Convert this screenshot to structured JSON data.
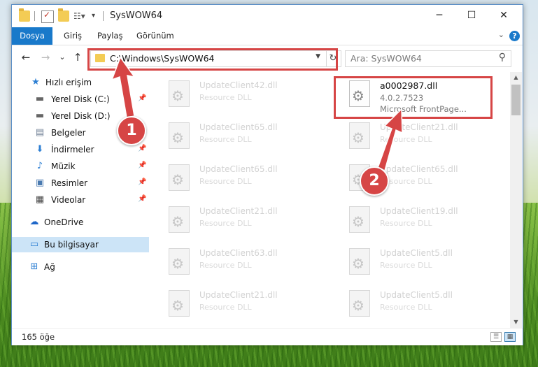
{
  "window": {
    "title": "SysWOW64",
    "minimize": "─",
    "maximize": "☐",
    "close": "✕"
  },
  "ribbon": {
    "tabs": [
      "Dosya",
      "Giriş",
      "Paylaş",
      "Görünüm"
    ],
    "help": "?"
  },
  "nav": {
    "back": "←",
    "forward": "→",
    "recent": "⌄",
    "up": "↑",
    "address": "C:\\Windows\\SysWOW64",
    "refresh": "↻",
    "search_placeholder": "Ara: SysWOW64"
  },
  "sidebar": {
    "items": [
      {
        "label": "Hızlı erişim",
        "icon": "star-icon",
        "color": "#2d7fd3"
      },
      {
        "label": "Yerel Disk (C:)",
        "icon": "drive-icon"
      },
      {
        "label": "Yerel Disk (D:)",
        "icon": "drive-icon"
      },
      {
        "label": "Belgeler",
        "icon": "documents-icon"
      },
      {
        "label": "İndirmeler",
        "icon": "download-icon"
      },
      {
        "label": "Müzik",
        "icon": "music-icon"
      },
      {
        "label": "Resimler",
        "icon": "pictures-icon"
      },
      {
        "label": "Videolar",
        "icon": "videos-icon"
      },
      {
        "label": "OneDrive",
        "icon": "cloud-icon"
      },
      {
        "label": "Bu bilgisayar",
        "icon": "computer-icon"
      },
      {
        "label": "Ağ",
        "icon": "network-icon"
      }
    ]
  },
  "files": {
    "highlighted": {
      "name": "a0002987.dll",
      "version": "4.0.2.7523",
      "description": "Microsoft FrontPage..."
    },
    "left": [
      {
        "name": "UpdateClient42.dll",
        "type": "Resource DLL"
      },
      {
        "name": "UpdateClient65.dll",
        "type": "Resource DLL"
      },
      {
        "name": "UpdateClient65.dll",
        "type": "Resource DLL"
      },
      {
        "name": "UpdateClient21.dll",
        "type": "Resource DLL"
      },
      {
        "name": "UpdateClient63.dll",
        "type": "Resource DLL"
      },
      {
        "name": "UpdateClient21.dll",
        "type": "Resource DLL"
      }
    ],
    "right": [
      {
        "name": "UpdateClient21.dll",
        "type": "Resource DLL"
      },
      {
        "name": "UpdateClient65.dll",
        "type": "Resource DLL"
      },
      {
        "name": "UpdateClient19.dll",
        "type": "Resource DLL"
      },
      {
        "name": "UpdateClient5.dll",
        "type": "Resource DLL"
      },
      {
        "name": "UpdateClient5.dll",
        "type": "Resource DLL"
      }
    ]
  },
  "status": {
    "count": "165 öğe"
  },
  "annotations": {
    "step1": "1",
    "step2": "2",
    "color": "#d64545"
  }
}
